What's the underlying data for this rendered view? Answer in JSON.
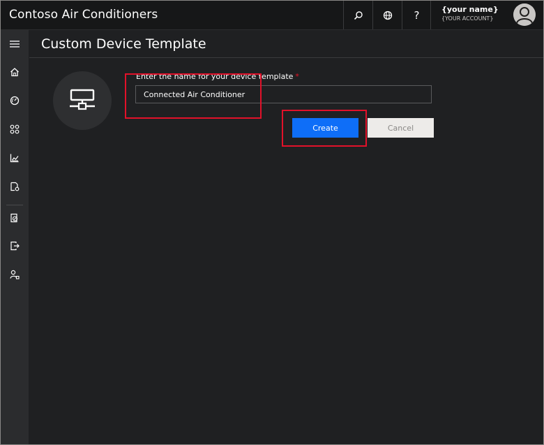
{
  "app": {
    "title": "Contoso Air Conditioners"
  },
  "topbar": {
    "search_icon": "search-icon",
    "globe_icon": "globe-icon",
    "help_label": "?",
    "user_name": "{your name}",
    "user_account": "{YOUR ACCOUNT}"
  },
  "rail": {
    "items": [
      {
        "icon": "hamburger-menu-icon"
      },
      {
        "icon": "home-icon"
      },
      {
        "icon": "dashboard-icon"
      },
      {
        "icon": "devices-icon"
      },
      {
        "icon": "analytics-icon"
      },
      {
        "icon": "device-templates-icon"
      },
      {
        "icon": "rules-icon"
      },
      {
        "icon": "export-icon"
      },
      {
        "icon": "administration-icon"
      }
    ]
  },
  "page": {
    "title": "Custom Device Template",
    "device_icon": "device-template-icon",
    "field_label": "Enter the name for your device template",
    "required_marker": "*",
    "input_value": "Connected Air Conditioner",
    "create_label": "Create",
    "cancel_label": "Cancel"
  },
  "colors": {
    "accent": "#0e6ef8",
    "annotation": "#e2112a",
    "required": "#e81123"
  }
}
